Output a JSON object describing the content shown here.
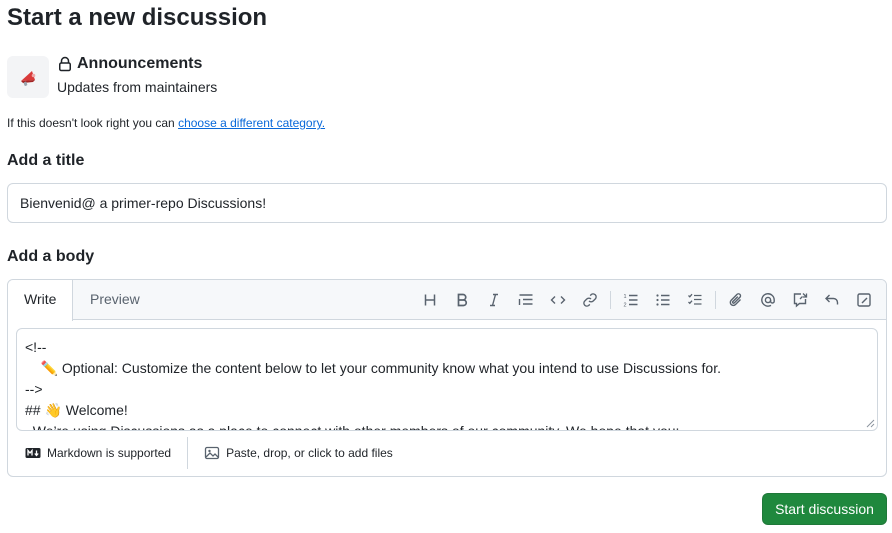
{
  "page": {
    "title": "Start a new discussion"
  },
  "category": {
    "name": "Announcements",
    "description": "Updates from maintainers",
    "icon": "megaphone-icon"
  },
  "hint": {
    "text": "If this doesn't look right you can ",
    "link": "choose a different category."
  },
  "title_field": {
    "label": "Add a title",
    "value": "Bienvenid@ a primer-repo Discussions!"
  },
  "body_field": {
    "label": "Add a body",
    "tabs": [
      "Write",
      "Preview"
    ],
    "toolbar": [
      "heading-icon",
      "bold-icon",
      "italic-icon",
      "quote-icon",
      "code-icon",
      "link-icon",
      "numbered-list-icon",
      "bulleted-list-icon",
      "task-list-icon",
      "attach-icon",
      "mention-icon",
      "reference-icon",
      "undo-icon",
      "fullscreen-icon"
    ],
    "content_lines": [
      "<!--",
      "    ✏️ Optional: Customize the content below to let your community know what you intend to use Discussions for.",
      "-->",
      "## 👋 Welcome!",
      "  We’re using Discussions as a place to connect with other members of our community. We hope that you:"
    ],
    "footer": {
      "markdown": "Markdown is supported",
      "attach": "Paste, drop, or click to add files"
    }
  },
  "submit": {
    "label": "Start discussion",
    "color": "#1f883d"
  },
  "colors": {
    "link": "#0969da",
    "border": "#d0d7de",
    "muted": "#59636e"
  }
}
